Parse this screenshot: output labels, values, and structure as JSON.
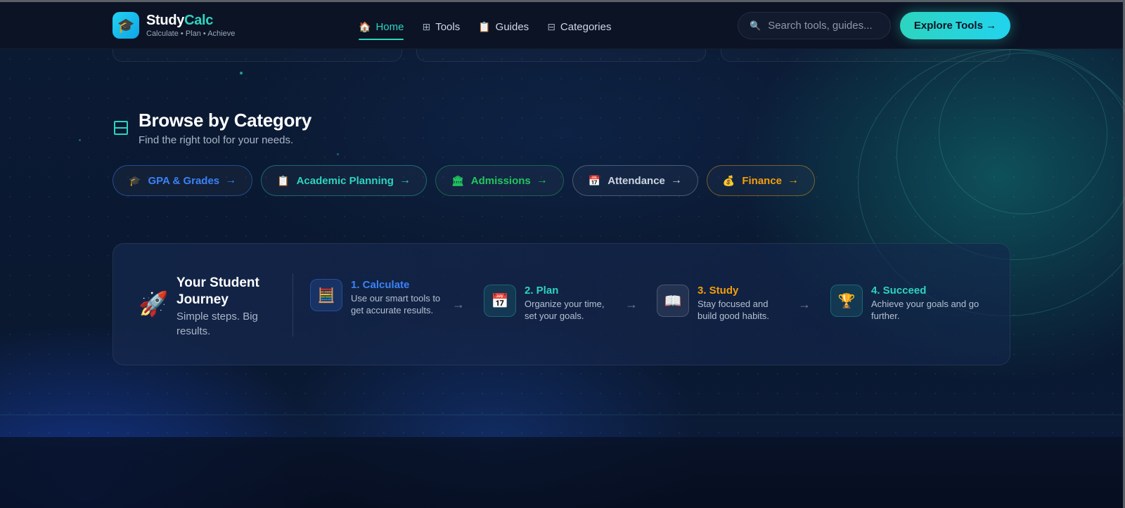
{
  "brand": {
    "name_main": "Study",
    "name_accent": "Calc",
    "tagline": "Calculate • Plan • Achieve",
    "logo_icon": "graduation-cap-icon"
  },
  "nav": {
    "items": [
      {
        "label": "Home",
        "icon": "🏠",
        "active": true
      },
      {
        "label": "Tools",
        "icon": "⊞",
        "active": false
      },
      {
        "label": "Guides",
        "icon": "📋",
        "active": false
      },
      {
        "label": "Categories",
        "icon": "⊟",
        "active": false
      }
    ],
    "search_placeholder": "Search tools, guides...",
    "cta_label": "Explore Tools →"
  },
  "categories_section": {
    "title": "Browse by Category",
    "subtitle": "Find the right tool for your needs.",
    "items": [
      {
        "label": "GPA & Grades",
        "icon": "🎓",
        "arrow": "→",
        "color": "#3b82f6"
      },
      {
        "label": "Academic Planning",
        "icon": "📋",
        "arrow": "→",
        "color": "#2dd4bf"
      },
      {
        "label": "Admissions",
        "icon": "🏛",
        "arrow": "→",
        "color": "#22c55e"
      },
      {
        "label": "Attendance",
        "icon": "📅",
        "arrow": "→",
        "color": "#cbd5e1"
      },
      {
        "label": "Finance",
        "icon": "💰",
        "arrow": "→",
        "color": "#f59e0b"
      }
    ]
  },
  "journey": {
    "icon": "🚀",
    "title": "Your Student Journey",
    "subtitle": "Simple steps. Big results.",
    "arrow": "→",
    "steps": [
      {
        "title": "1. Calculate",
        "desc": "Use our smart tools to get accurate results.",
        "icon": "🧮",
        "color": "#3b82f6"
      },
      {
        "title": "2. Plan",
        "desc": "Organize your time, set your goals.",
        "icon": "📅",
        "color": "#2dd4bf"
      },
      {
        "title": "3. Study",
        "desc": "Stay focused and build good habits.",
        "icon": "📖",
        "color": "#f59e0b"
      },
      {
        "title": "4. Succeed",
        "desc": "Achieve your goals and go further.",
        "icon": "🏆",
        "color": "#2dd4bf"
      }
    ]
  }
}
